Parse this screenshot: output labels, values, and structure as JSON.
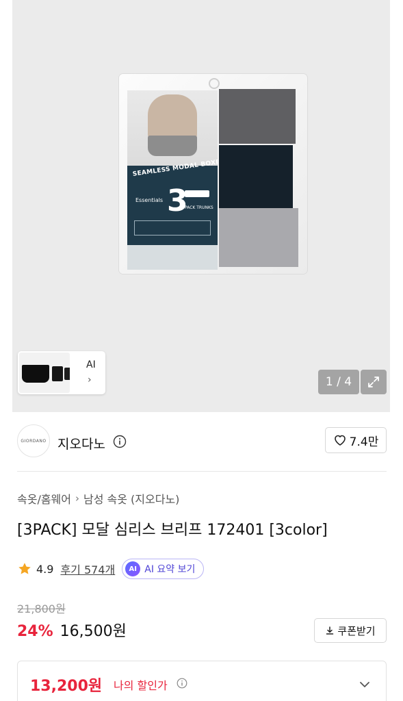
{
  "gallery": {
    "counter": "1 / 4",
    "thumb_label": "AI",
    "thumb_chevron": "›",
    "package_text": {
      "line1": "SEAMLESS MODAL BOXER BRIEFS",
      "count": "3",
      "brand": "Essentials",
      "pack": "PACK TRUNKS"
    }
  },
  "seller": {
    "logo_text": "GIORDANO",
    "name": "지오다노",
    "likes": "7.4만"
  },
  "product": {
    "breadcrumb": [
      "속옷/홈웨어",
      "남성 속옷 (지오다노)"
    ],
    "breadcrumb_sep": "›",
    "title": "[3PACK] 모달 심리스 브리프 172401 [3color]",
    "rating": "4.9",
    "reviews": "후기 574개",
    "ai_badge": "AI",
    "ai_summary": "AI 요약 보기",
    "original_price": "21,800원",
    "discount": "24%",
    "price": "16,500원",
    "coupon": "쿠폰받기",
    "my_price": "13,200원",
    "my_price_label": "나의 할인가"
  },
  "colors": {
    "accent_red": "#e8243c",
    "ai_purple": "#4f44d6",
    "star": "#f5a623"
  },
  "icons": [
    "expand-icon",
    "info-icon",
    "heart-icon",
    "star-icon",
    "download-icon",
    "chevron-down-icon"
  ]
}
